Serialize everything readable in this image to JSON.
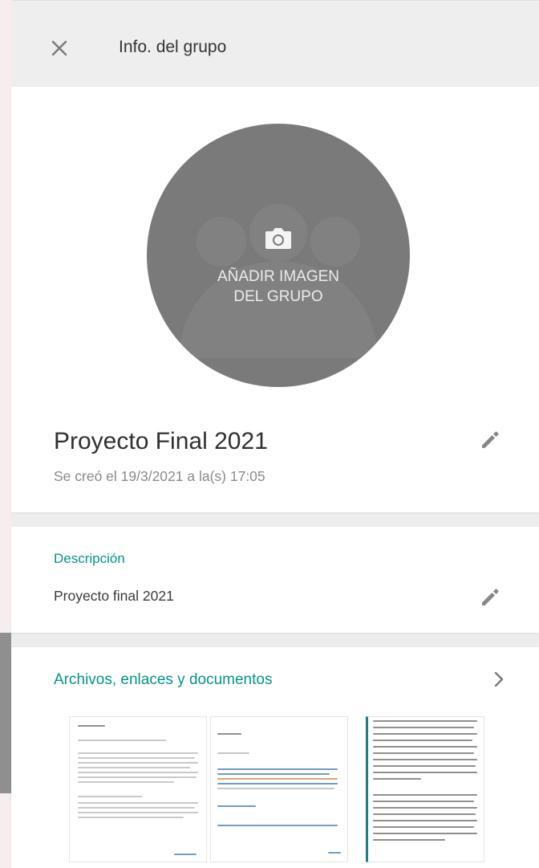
{
  "header": {
    "title": "Info. del grupo",
    "close_icon": "close-icon"
  },
  "group": {
    "avatar_label_line1": "AÑADIR IMAGEN",
    "avatar_label_line2": "DEL GRUPO",
    "name": "Proyecto Final 2021",
    "created": "Se creó el 19/3/2021 a la(s) 17:05",
    "camera_icon": "camera-icon",
    "edit_icon": "pencil-icon"
  },
  "description": {
    "title": "Descripción",
    "text": "Proyecto final 2021",
    "edit_icon": "pencil-icon"
  },
  "files": {
    "title": "Archivos, enlaces y documentos",
    "chevron_icon": "chevron-right-icon",
    "thumbnails": [
      "document-thumbnail-1",
      "document-thumbnail-2",
      "document-thumbnail-3"
    ]
  },
  "colors": {
    "accent": "#009688",
    "avatar_bg": "#7a7a7a",
    "header_bg": "#eeeeee",
    "panel_bg": "#ededed"
  }
}
